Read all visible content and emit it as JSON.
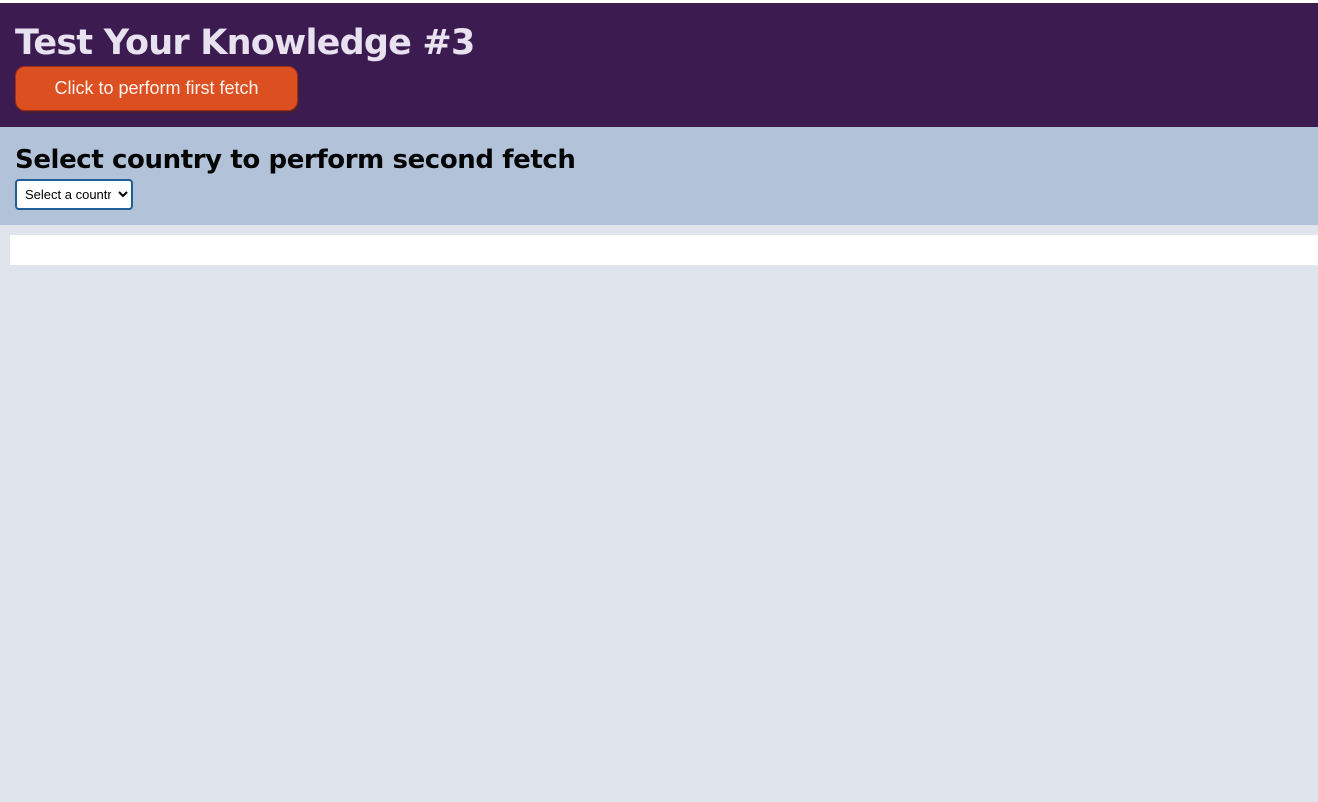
{
  "header": {
    "title": "Test Your Knowledge #3",
    "button_label": "Click to perform first fetch"
  },
  "country_section": {
    "title": "Select country to perform second fetch",
    "select": {
      "selected_value": "Select a country",
      "options": [
        "Select a country"
      ]
    }
  },
  "results": {
    "content": ""
  },
  "colors": {
    "header_background": "#3c1c50",
    "button_background": "#dc4f21",
    "section_background": "#b1c2d9",
    "page_background": "#e0e5ed",
    "panel_background": "#ffffff"
  }
}
